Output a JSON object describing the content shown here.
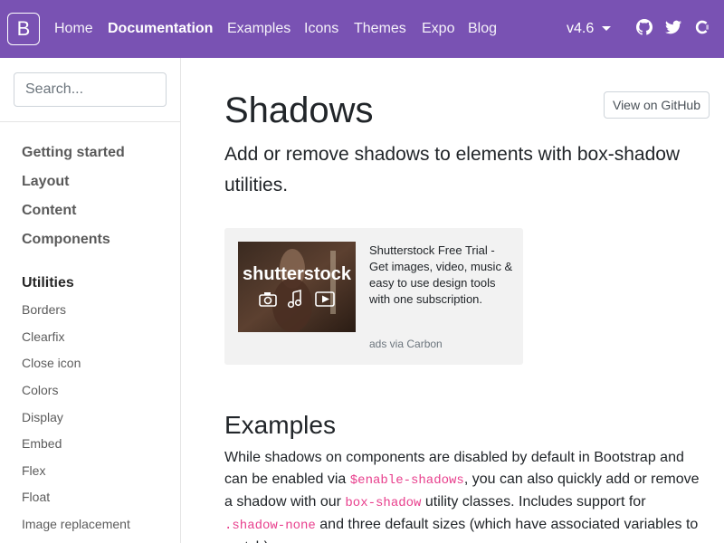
{
  "navbar": {
    "brand": "B",
    "links": [
      {
        "label": "Home",
        "active": false
      },
      {
        "label": "Documentation",
        "active": true
      },
      {
        "label": "Examples",
        "active": false
      },
      {
        "label": "Icons",
        "active": false
      },
      {
        "label": "Themes",
        "active": false
      },
      {
        "label": "Expo",
        "active": false
      },
      {
        "label": "Blog",
        "active": false
      }
    ],
    "version": "v4.6",
    "icons": [
      "github-icon",
      "twitter-icon",
      "opencollective-icon"
    ],
    "background_color": "#7952b3"
  },
  "sidebar": {
    "search_placeholder": "Search...",
    "groups": [
      "Getting started",
      "Layout",
      "Content",
      "Components"
    ],
    "current_group": "Utilities",
    "items": [
      "Borders",
      "Clearfix",
      "Close icon",
      "Colors",
      "Display",
      "Embed",
      "Flex",
      "Float",
      "Image replacement"
    ]
  },
  "main": {
    "title": "Shadows",
    "github_button": "View on GitHub",
    "lead": "Add or remove shadows to elements with box-shadow utilities.",
    "ad": {
      "image_text": "shutterstock",
      "text": "Shutterstock Free Trial - Get images, video, music & easy to use design tools with one subscription.",
      "powered_by": "ads via Carbon"
    },
    "examples_heading": "Examples",
    "examples_paragraph": {
      "t1": "While shadows on components are disabled by default in Bootstrap and can be enabled via ",
      "c1": "$enable-shadows",
      "t2": ", you can also quickly add or remove a shadow with our ",
      "c2": "box-shadow",
      "t3": " utility classes. Includes support for ",
      "c3": ".shadow-none",
      "t4": " and three default sizes (which have associated variables to match)."
    }
  }
}
